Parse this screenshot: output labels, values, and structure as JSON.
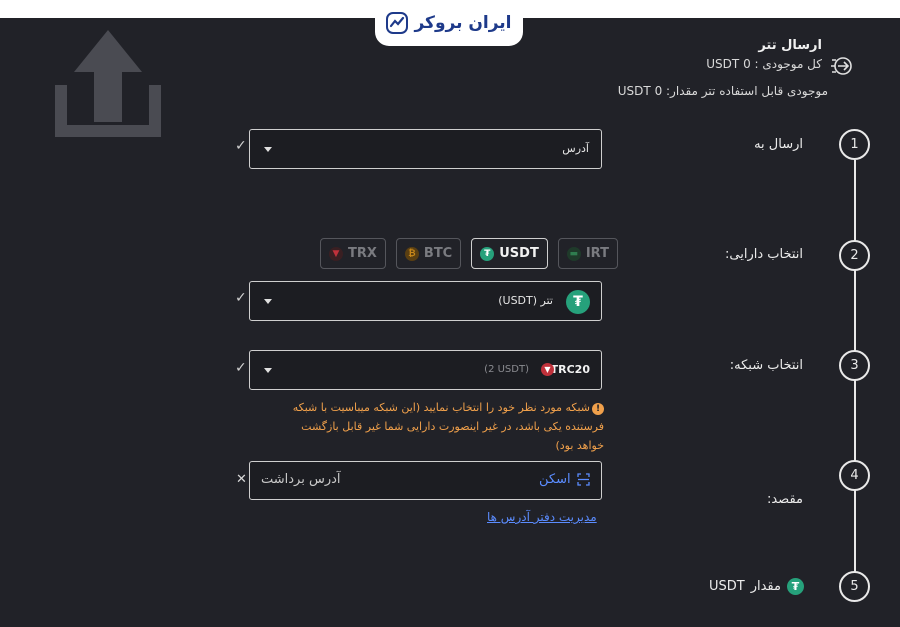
{
  "brand": {
    "logo_text": "ایران بروکر"
  },
  "header": {
    "title": "ارسال تتر",
    "total_balance": "کل موجودی : 0 USDT",
    "usable_balance": "موجودی قابل استفاده تتر مقدار: 0 USDT"
  },
  "steps": [
    {
      "number": "1",
      "label": "ارسال به"
    },
    {
      "number": "2",
      "label": "انتخاب دارایی:"
    },
    {
      "number": "3",
      "label": "انتخاب شبکه:"
    },
    {
      "number": "4",
      "label": "مقصد:"
    },
    {
      "number": "5",
      "label": "مقدار"
    }
  ],
  "send_to": {
    "value": "آدرس"
  },
  "asset_chips": [
    {
      "label": "TRX",
      "color": "#c0313b"
    },
    {
      "label": "BTC",
      "color": "#c9881a"
    },
    {
      "label": "USDT",
      "color": "#26a17b",
      "active": true
    },
    {
      "label": "IRT",
      "color": "#2f7d4f"
    }
  ],
  "asset_select": {
    "value": "تتر (USDT)",
    "icon": "tether-icon"
  },
  "network_select": {
    "network": "TRC20",
    "fee": "(2 USDT)"
  },
  "network_warning": "شبکه مورد نظر خود را انتخاب نمایید (این شبکه میباسیت با شبکه فرستنده یکی باشد، در غیر اینصورت دارایی شما غیر قابل بازگشت خواهد بود)",
  "destination": {
    "placeholder": "آدرس برداشت",
    "scan_label": "اسکن",
    "clear": "✕"
  },
  "address_book_link": "مدیریت دفتر آدرس ها",
  "amount_label": {
    "currency": "USDT"
  },
  "check_mark": "✓",
  "colors": {
    "background": "#212228",
    "link": "#5b8cff",
    "warning": "#f0a04b",
    "tether": "#26a17b"
  }
}
